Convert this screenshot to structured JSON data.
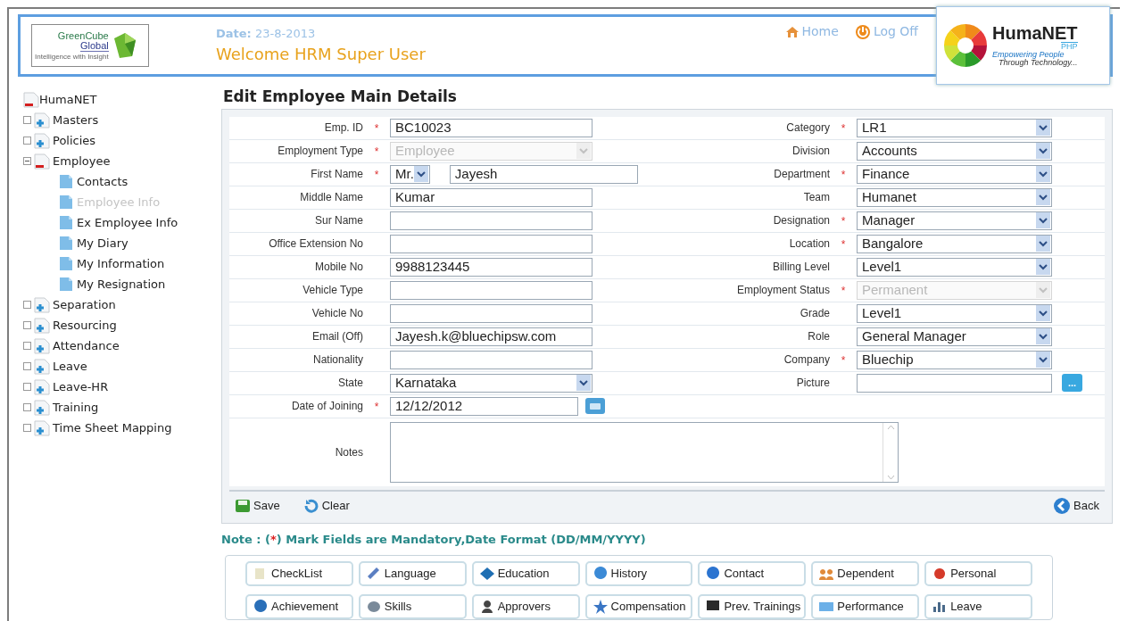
{
  "header": {
    "logo": {
      "line1": "GreenCube",
      "line2": "Global",
      "tagline": "Intelligence with Insight"
    },
    "date_label": "Date:",
    "date": "23-8-2013",
    "welcome": "Welcome HRM Super User",
    "links": [
      {
        "kind": "home",
        "label": "Home"
      },
      {
        "kind": "logoff",
        "label": "Log Off"
      }
    ],
    "brand": {
      "name": "HumaNET",
      "suffix": "PHP",
      "line1": "Empowering People",
      "line2": "Through Technology..."
    }
  },
  "tree": {
    "label": "HumaNET",
    "expanded": true,
    "selected": false,
    "children": [
      {
        "label": "Masters",
        "expanded": false,
        "selected": false
      },
      {
        "label": "Policies",
        "expanded": false,
        "selected": false
      },
      {
        "label": "Employee",
        "expanded": true,
        "selected": false,
        "children": [
          {
            "label": "Contacts",
            "selected": false
          },
          {
            "label": "Employee Info",
            "selected": true
          },
          {
            "label": "Ex Employee Info",
            "selected": false
          },
          {
            "label": "My Diary",
            "selected": false
          },
          {
            "label": "My Information",
            "selected": false
          },
          {
            "label": "My Resignation",
            "selected": false
          }
        ]
      },
      {
        "label": "Separation",
        "expanded": false,
        "selected": false
      },
      {
        "label": "Resourcing",
        "expanded": false,
        "selected": false
      },
      {
        "label": "Attendance",
        "expanded": false,
        "selected": false
      },
      {
        "label": "Leave",
        "expanded": false,
        "selected": false
      },
      {
        "label": "Leave-HR",
        "expanded": false,
        "selected": false
      },
      {
        "label": "Training",
        "expanded": false,
        "selected": false
      },
      {
        "label": "Time Sheet Mapping",
        "expanded": false,
        "selected": false
      }
    ]
  },
  "page_title": "Edit Employee Main Details",
  "form": {
    "required_mark": "*",
    "left": [
      {
        "label": "Emp. ID",
        "required": true,
        "kind": "text",
        "value": "BC10023"
      },
      {
        "label": "Employment Type",
        "required": true,
        "kind": "select",
        "value": "Employee",
        "disabled": true
      },
      {
        "label": "First Name",
        "required": true,
        "kind": "name",
        "title": "Mr.",
        "value": "Jayesh"
      },
      {
        "label": "Middle Name",
        "required": false,
        "kind": "text",
        "value": "Kumar"
      },
      {
        "label": "Sur Name",
        "required": false,
        "kind": "text"
      },
      {
        "label": "Office Extension No",
        "required": false,
        "kind": "text"
      },
      {
        "label": "Mobile No",
        "required": false,
        "kind": "text",
        "value": "9988123445"
      },
      {
        "label": "Vehicle Type",
        "required": false,
        "kind": "text"
      },
      {
        "label": "Vehicle No",
        "required": false,
        "kind": "text"
      },
      {
        "label": "Email (Off)",
        "required": false,
        "kind": "text",
        "value": "Jayesh.k@bluechipsw.com"
      },
      {
        "label": "Nationality",
        "required": false,
        "kind": "text"
      },
      {
        "label": "State",
        "required": false,
        "kind": "select",
        "value": "Karnataka",
        "disabled": false
      },
      {
        "label": "Date of Joining",
        "required": true,
        "kind": "date",
        "value": "12/12/2012"
      }
    ],
    "right": [
      {
        "label": "Category",
        "required": true,
        "kind": "select",
        "value": "LR1",
        "disabled": false
      },
      {
        "label": "Division",
        "required": false,
        "kind": "select",
        "value": "Accounts",
        "disabled": false
      },
      {
        "label": "Department",
        "required": true,
        "kind": "select",
        "value": "Finance",
        "disabled": false
      },
      {
        "label": "Team",
        "required": false,
        "kind": "select",
        "value": "Humanet",
        "disabled": false
      },
      {
        "label": "Designation",
        "required": true,
        "kind": "select",
        "value": "Manager",
        "disabled": false
      },
      {
        "label": "Location",
        "required": true,
        "kind": "select",
        "value": "Bangalore",
        "disabled": false
      },
      {
        "label": "Billing Level",
        "required": false,
        "kind": "select",
        "value": "Level1",
        "disabled": false
      },
      {
        "label": "Employment Status",
        "required": true,
        "kind": "select",
        "value": "Permanent",
        "disabled": true
      },
      {
        "label": "Grade",
        "required": false,
        "kind": "select",
        "value": "Level1",
        "disabled": false
      },
      {
        "label": "Role",
        "required": false,
        "kind": "select",
        "value": "General Manager",
        "disabled": false
      },
      {
        "label": "Company",
        "required": true,
        "kind": "select",
        "value": "Bluechip",
        "disabled": false
      },
      {
        "label": "Picture",
        "required": false,
        "kind": "file",
        "button_label": "..."
      }
    ],
    "notes": {
      "label": "Notes"
    }
  },
  "actions": [
    {
      "kind": "save",
      "label": "Save"
    },
    {
      "kind": "clear",
      "label": "Clear"
    },
    {
      "kind": "back",
      "label": "Back"
    }
  ],
  "note": {
    "before": "Note : (",
    "mark": "*",
    "after": ") Mark Fields are Mandatory,Date Format (DD/MM/YYYY)"
  },
  "sections": [
    "CheckList",
    "Language",
    "Education",
    "History",
    "Contact",
    "Dependent",
    "Personal",
    "Achievement",
    "Skills",
    "Approvers",
    "Compensation",
    "Prev. Trainings",
    "Performance",
    "Leave"
  ]
}
